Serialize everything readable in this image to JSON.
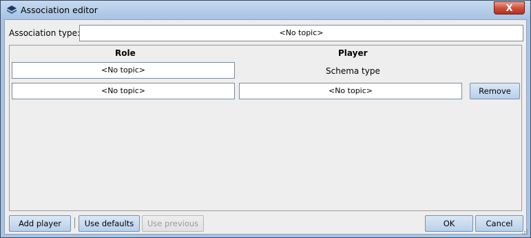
{
  "window": {
    "title": "Association editor",
    "close_label": "X"
  },
  "association": {
    "label": "Association type:",
    "value": "<No topic>"
  },
  "table": {
    "role_header": "Role",
    "player_header": "Player",
    "rows": [
      {
        "role": "<No topic>",
        "player": "Schema type"
      },
      {
        "role": "<No topic>",
        "player": "<No topic>",
        "action": "Remove"
      }
    ]
  },
  "footer": {
    "add_player": "Add player",
    "use_defaults": "Use defaults",
    "use_previous": "Use previous",
    "ok": "OK",
    "cancel": "Cancel"
  }
}
